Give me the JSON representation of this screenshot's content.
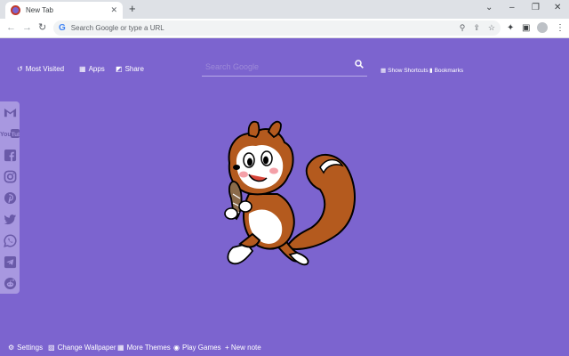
{
  "browser": {
    "tab_title": "New Tab",
    "new_tab": "+",
    "omnibox_placeholder": "Search Google or type a URL",
    "google_logo": "G"
  },
  "ntp": {
    "most_visited": "Most Visited",
    "apps": "Apps",
    "share": "Share",
    "search_placeholder": "Search Google",
    "show_shortcuts": "Show Shortcuts",
    "bookmarks": "Bookmarks"
  },
  "sidebar": {
    "items": [
      {
        "name": "gmail",
        "icon": "gmail-icon"
      },
      {
        "name": "youtube",
        "icon": "youtube-icon",
        "label": "YouTube"
      },
      {
        "name": "facebook",
        "icon": "facebook-icon"
      },
      {
        "name": "instagram",
        "icon": "instagram-icon"
      },
      {
        "name": "pinterest",
        "icon": "pinterest-icon"
      },
      {
        "name": "twitter",
        "icon": "twitter-icon"
      },
      {
        "name": "whatsapp",
        "icon": "whatsapp-icon"
      },
      {
        "name": "telegram",
        "icon": "telegram-icon"
      },
      {
        "name": "reddit",
        "icon": "reddit-icon"
      }
    ]
  },
  "footer": {
    "settings": "Settings",
    "change_wallpaper": "Change Wallpaper",
    "more_themes": "More Themes",
    "play_games": "Play Games",
    "new_note": "+ New note"
  },
  "colors": {
    "background": "#7c64cf",
    "sidebar": "#a898e0",
    "mascot_fur": "#b45a1e"
  }
}
